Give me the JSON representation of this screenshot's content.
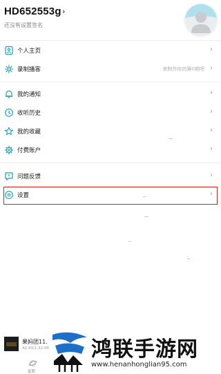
{
  "profile": {
    "username": "HD652553g",
    "signature": "还没有设置签名",
    "avatar_icon": "avatar-placeholder-icon"
  },
  "menu_group_1": [
    {
      "label": "个人主页",
      "icon": "user-card-icon",
      "hint": ""
    },
    {
      "label": "录制播客",
      "icon": "record-sparkle-icon",
      "hint": "来制作你的第0期吧"
    }
  ],
  "menu_group_2": [
    {
      "label": "我的通知",
      "icon": "bell-icon",
      "hint": ""
    },
    {
      "label": "收听历史",
      "icon": "clock-icon",
      "hint": ""
    },
    {
      "label": "我的收藏",
      "icon": "star-icon",
      "hint": ""
    },
    {
      "label": "付费账户",
      "icon": "gear-icon",
      "hint": ""
    }
  ],
  "menu_group_3": [
    {
      "label": "问题反馈",
      "icon": "feedback-icon",
      "hint": ""
    },
    {
      "label": "设置",
      "icon": "settings-icon",
      "hint": ""
    }
  ],
  "chevron": "›",
  "mini_player": {
    "title": "果妈团11.",
    "time": "42:43/1:32:08"
  },
  "bottom_nav": {
    "label": "星期"
  },
  "watermark": {
    "text": "鸿联手游网",
    "url": "www.henanhonglian95.com"
  },
  "colors": {
    "accent": "#1aa0b8",
    "highlight_border": "#e02020",
    "divider": "#eeeeee"
  }
}
